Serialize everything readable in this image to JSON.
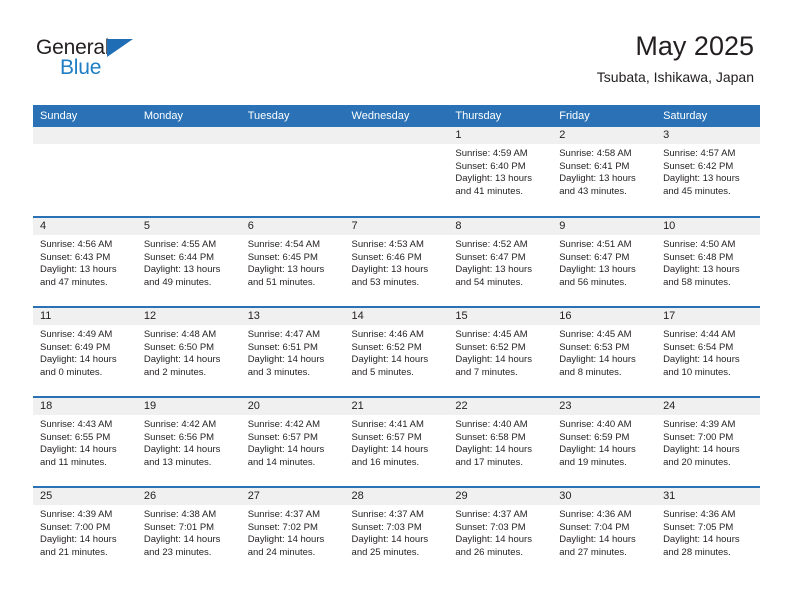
{
  "brand": {
    "name_part1": "General",
    "name_part2": "Blue",
    "flag_icon": "blue-triangle-flag-icon",
    "colors": {
      "dark": "#231f20",
      "blue": "#1f7ec4",
      "header_blue": "#2a72b5"
    }
  },
  "header": {
    "title": "May 2025",
    "subtitle": "Tsubata, Ishikawa, Japan"
  },
  "calendar": {
    "weekday_headers": [
      "Sunday",
      "Monday",
      "Tuesday",
      "Wednesday",
      "Thursday",
      "Friday",
      "Saturday"
    ],
    "weeks": [
      [
        {
          "day": "",
          "empty": true,
          "sunrise": "",
          "sunset": "",
          "daylight_line1": "",
          "daylight_line2": ""
        },
        {
          "day": "",
          "empty": true,
          "sunrise": "",
          "sunset": "",
          "daylight_line1": "",
          "daylight_line2": ""
        },
        {
          "day": "",
          "empty": true,
          "sunrise": "",
          "sunset": "",
          "daylight_line1": "",
          "daylight_line2": ""
        },
        {
          "day": "",
          "empty": true,
          "sunrise": "",
          "sunset": "",
          "daylight_line1": "",
          "daylight_line2": ""
        },
        {
          "day": "1",
          "empty": false,
          "sunrise": "Sunrise: 4:59 AM",
          "sunset": "Sunset: 6:40 PM",
          "daylight_line1": "Daylight: 13 hours",
          "daylight_line2": "and 41 minutes."
        },
        {
          "day": "2",
          "empty": false,
          "sunrise": "Sunrise: 4:58 AM",
          "sunset": "Sunset: 6:41 PM",
          "daylight_line1": "Daylight: 13 hours",
          "daylight_line2": "and 43 minutes."
        },
        {
          "day": "3",
          "empty": false,
          "sunrise": "Sunrise: 4:57 AM",
          "sunset": "Sunset: 6:42 PM",
          "daylight_line1": "Daylight: 13 hours",
          "daylight_line2": "and 45 minutes."
        }
      ],
      [
        {
          "day": "4",
          "empty": false,
          "sunrise": "Sunrise: 4:56 AM",
          "sunset": "Sunset: 6:43 PM",
          "daylight_line1": "Daylight: 13 hours",
          "daylight_line2": "and 47 minutes."
        },
        {
          "day": "5",
          "empty": false,
          "sunrise": "Sunrise: 4:55 AM",
          "sunset": "Sunset: 6:44 PM",
          "daylight_line1": "Daylight: 13 hours",
          "daylight_line2": "and 49 minutes."
        },
        {
          "day": "6",
          "empty": false,
          "sunrise": "Sunrise: 4:54 AM",
          "sunset": "Sunset: 6:45 PM",
          "daylight_line1": "Daylight: 13 hours",
          "daylight_line2": "and 51 minutes."
        },
        {
          "day": "7",
          "empty": false,
          "sunrise": "Sunrise: 4:53 AM",
          "sunset": "Sunset: 6:46 PM",
          "daylight_line1": "Daylight: 13 hours",
          "daylight_line2": "and 53 minutes."
        },
        {
          "day": "8",
          "empty": false,
          "sunrise": "Sunrise: 4:52 AM",
          "sunset": "Sunset: 6:47 PM",
          "daylight_line1": "Daylight: 13 hours",
          "daylight_line2": "and 54 minutes."
        },
        {
          "day": "9",
          "empty": false,
          "sunrise": "Sunrise: 4:51 AM",
          "sunset": "Sunset: 6:47 PM",
          "daylight_line1": "Daylight: 13 hours",
          "daylight_line2": "and 56 minutes."
        },
        {
          "day": "10",
          "empty": false,
          "sunrise": "Sunrise: 4:50 AM",
          "sunset": "Sunset: 6:48 PM",
          "daylight_line1": "Daylight: 13 hours",
          "daylight_line2": "and 58 minutes."
        }
      ],
      [
        {
          "day": "11",
          "empty": false,
          "sunrise": "Sunrise: 4:49 AM",
          "sunset": "Sunset: 6:49 PM",
          "daylight_line1": "Daylight: 14 hours",
          "daylight_line2": "and 0 minutes."
        },
        {
          "day": "12",
          "empty": false,
          "sunrise": "Sunrise: 4:48 AM",
          "sunset": "Sunset: 6:50 PM",
          "daylight_line1": "Daylight: 14 hours",
          "daylight_line2": "and 2 minutes."
        },
        {
          "day": "13",
          "empty": false,
          "sunrise": "Sunrise: 4:47 AM",
          "sunset": "Sunset: 6:51 PM",
          "daylight_line1": "Daylight: 14 hours",
          "daylight_line2": "and 3 minutes."
        },
        {
          "day": "14",
          "empty": false,
          "sunrise": "Sunrise: 4:46 AM",
          "sunset": "Sunset: 6:52 PM",
          "daylight_line1": "Daylight: 14 hours",
          "daylight_line2": "and 5 minutes."
        },
        {
          "day": "15",
          "empty": false,
          "sunrise": "Sunrise: 4:45 AM",
          "sunset": "Sunset: 6:52 PM",
          "daylight_line1": "Daylight: 14 hours",
          "daylight_line2": "and 7 minutes."
        },
        {
          "day": "16",
          "empty": false,
          "sunrise": "Sunrise: 4:45 AM",
          "sunset": "Sunset: 6:53 PM",
          "daylight_line1": "Daylight: 14 hours",
          "daylight_line2": "and 8 minutes."
        },
        {
          "day": "17",
          "empty": false,
          "sunrise": "Sunrise: 4:44 AM",
          "sunset": "Sunset: 6:54 PM",
          "daylight_line1": "Daylight: 14 hours",
          "daylight_line2": "and 10 minutes."
        }
      ],
      [
        {
          "day": "18",
          "empty": false,
          "sunrise": "Sunrise: 4:43 AM",
          "sunset": "Sunset: 6:55 PM",
          "daylight_line1": "Daylight: 14 hours",
          "daylight_line2": "and 11 minutes."
        },
        {
          "day": "19",
          "empty": false,
          "sunrise": "Sunrise: 4:42 AM",
          "sunset": "Sunset: 6:56 PM",
          "daylight_line1": "Daylight: 14 hours",
          "daylight_line2": "and 13 minutes."
        },
        {
          "day": "20",
          "empty": false,
          "sunrise": "Sunrise: 4:42 AM",
          "sunset": "Sunset: 6:57 PM",
          "daylight_line1": "Daylight: 14 hours",
          "daylight_line2": "and 14 minutes."
        },
        {
          "day": "21",
          "empty": false,
          "sunrise": "Sunrise: 4:41 AM",
          "sunset": "Sunset: 6:57 PM",
          "daylight_line1": "Daylight: 14 hours",
          "daylight_line2": "and 16 minutes."
        },
        {
          "day": "22",
          "empty": false,
          "sunrise": "Sunrise: 4:40 AM",
          "sunset": "Sunset: 6:58 PM",
          "daylight_line1": "Daylight: 14 hours",
          "daylight_line2": "and 17 minutes."
        },
        {
          "day": "23",
          "empty": false,
          "sunrise": "Sunrise: 4:40 AM",
          "sunset": "Sunset: 6:59 PM",
          "daylight_line1": "Daylight: 14 hours",
          "daylight_line2": "and 19 minutes."
        },
        {
          "day": "24",
          "empty": false,
          "sunrise": "Sunrise: 4:39 AM",
          "sunset": "Sunset: 7:00 PM",
          "daylight_line1": "Daylight: 14 hours",
          "daylight_line2": "and 20 minutes."
        }
      ],
      [
        {
          "day": "25",
          "empty": false,
          "sunrise": "Sunrise: 4:39 AM",
          "sunset": "Sunset: 7:00 PM",
          "daylight_line1": "Daylight: 14 hours",
          "daylight_line2": "and 21 minutes."
        },
        {
          "day": "26",
          "empty": false,
          "sunrise": "Sunrise: 4:38 AM",
          "sunset": "Sunset: 7:01 PM",
          "daylight_line1": "Daylight: 14 hours",
          "daylight_line2": "and 23 minutes."
        },
        {
          "day": "27",
          "empty": false,
          "sunrise": "Sunrise: 4:37 AM",
          "sunset": "Sunset: 7:02 PM",
          "daylight_line1": "Daylight: 14 hours",
          "daylight_line2": "and 24 minutes."
        },
        {
          "day": "28",
          "empty": false,
          "sunrise": "Sunrise: 4:37 AM",
          "sunset": "Sunset: 7:03 PM",
          "daylight_line1": "Daylight: 14 hours",
          "daylight_line2": "and 25 minutes."
        },
        {
          "day": "29",
          "empty": false,
          "sunrise": "Sunrise: 4:37 AM",
          "sunset": "Sunset: 7:03 PM",
          "daylight_line1": "Daylight: 14 hours",
          "daylight_line2": "and 26 minutes."
        },
        {
          "day": "30",
          "empty": false,
          "sunrise": "Sunrise: 4:36 AM",
          "sunset": "Sunset: 7:04 PM",
          "daylight_line1": "Daylight: 14 hours",
          "daylight_line2": "and 27 minutes."
        },
        {
          "day": "31",
          "empty": false,
          "sunrise": "Sunrise: 4:36 AM",
          "sunset": "Sunset: 7:05 PM",
          "daylight_line1": "Daylight: 14 hours",
          "daylight_line2": "and 28 minutes."
        }
      ]
    ]
  }
}
